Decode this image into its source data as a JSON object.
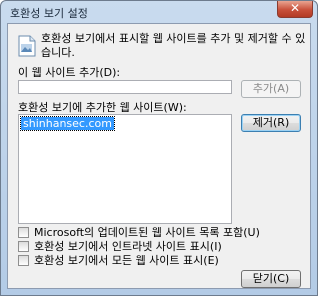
{
  "window": {
    "title": "호환성 보기 설정",
    "close_glyph": "✕"
  },
  "intro": "호환성 보기에서 표시할 웹 사이트를 추가 및 제거할 수 있습니다.",
  "add_site": {
    "label": "이 웹 사이트 추가(D):",
    "value": "",
    "button": "추가(A)"
  },
  "site_list": {
    "label": "호환성 보기에 추가한 웹 사이트(W):",
    "items": [
      "shinhansec.com"
    ],
    "remove_button": "제거(R)"
  },
  "options": [
    {
      "label": "Microsoft의 업데이트된 웹 사이트 목록 포함(U)",
      "checked": false
    },
    {
      "label": "호환성 보기에서 인트라넷 사이트 표시(I)",
      "checked": false
    },
    {
      "label": "호환성 보기에서 모든 웹 사이트 표시(E)",
      "checked": false
    }
  ],
  "close_button": "닫기(C)",
  "icons": {
    "info": "document-info-icon",
    "close": "close-icon"
  },
  "colors": {
    "selection": "#3399ff",
    "title_bar": "#c9dbee",
    "close_button": "#c8503a"
  }
}
